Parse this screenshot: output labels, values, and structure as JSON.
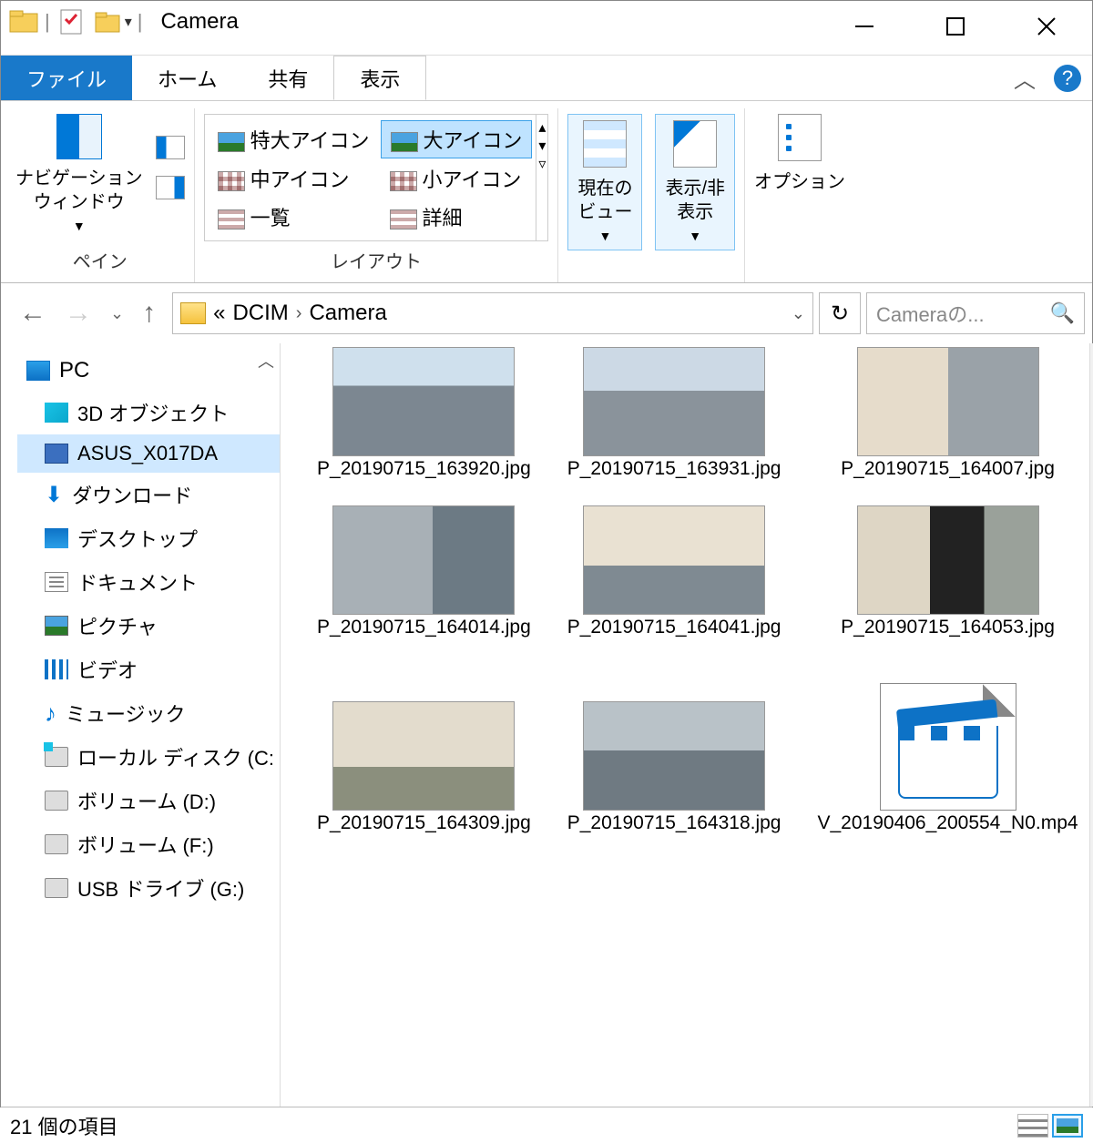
{
  "window": {
    "title": "Camera"
  },
  "tabs": {
    "file": "ファイル",
    "home": "ホーム",
    "share": "共有",
    "view": "表示"
  },
  "ribbon": {
    "panes_group": "ペイン",
    "nav_pane": "ナビゲーション\nウィンドウ",
    "layout_group": "レイアウト",
    "layout": {
      "extra_large": "特大アイコン",
      "large": "大アイコン",
      "medium": "中アイコン",
      "small": "小アイコン",
      "list": "一覧",
      "details": "詳細"
    },
    "current_view": "現在の\nビュー",
    "show_hide": "表示/非\n表示",
    "options": "オプション"
  },
  "breadcrumb": {
    "prefix": "«",
    "p1": "DCIM",
    "p2": "Camera"
  },
  "search": {
    "placeholder": "Cameraの..."
  },
  "tree": {
    "pc": "PC",
    "items": [
      "3D オブジェクト",
      "ASUS_X017DA",
      "ダウンロード",
      "デスクトップ",
      "ドキュメント",
      "ピクチャ",
      "ビデオ",
      "ミュージック",
      "ローカル ディスク (C:",
      "ボリューム (D:)",
      "ボリューム (F:)",
      "USB ドライブ (G:)"
    ]
  },
  "files": [
    {
      "name": "P_20190715_163920.jpg"
    },
    {
      "name": "P_20190715_163931.jpg"
    },
    {
      "name": "P_20190715_164007.jpg"
    },
    {
      "name": "P_20190715_164014.jpg"
    },
    {
      "name": "P_20190715_164041.jpg"
    },
    {
      "name": "P_20190715_164053.jpg"
    },
    {
      "name": "P_20190715_164309.jpg"
    },
    {
      "name": "P_20190715_164318.jpg"
    },
    {
      "name": "V_20190406_200554_N0.mp4"
    }
  ],
  "status": {
    "count": "21 個の項目"
  }
}
